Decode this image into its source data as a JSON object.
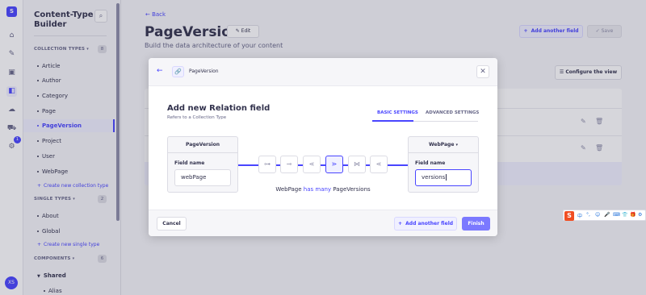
{
  "rail": {
    "logo": "S",
    "badge": "1",
    "avatar": "XS"
  },
  "subnav": {
    "title": "Content-Type Builder",
    "collection_types": {
      "label": "COLLECTION TYPES",
      "count": "8",
      "items": [
        "Article",
        "Author",
        "Category",
        "Page",
        "PageVersion",
        "Project",
        "User",
        "WebPage"
      ],
      "create": "Create new collection type"
    },
    "single_types": {
      "label": "SINGLE TYPES",
      "count": "2",
      "items": [
        "About",
        "Global"
      ],
      "create": "Create new single type"
    },
    "components": {
      "label": "COMPONENTS",
      "count": "6",
      "group": "Shared",
      "items": [
        "Alias"
      ]
    }
  },
  "main": {
    "back": "Back",
    "title": "PageVersion",
    "edit": "Edit",
    "subtitle": "Build the data architecture of your content",
    "add_another_field": "Add another field",
    "save": "Save",
    "configure_view": "Configure the view"
  },
  "modal": {
    "breadcrumb": "PageVersion",
    "title": "Add new Relation field",
    "subtitle": "Refers to a Collection Type",
    "tabs": [
      "BASIC SETTINGS",
      "ADVANCED SETTINGS"
    ],
    "left": {
      "header": "PageVersion",
      "label": "Field name",
      "value": "webPage"
    },
    "right": {
      "header": "WebPage",
      "label": "Field name",
      "value": "versions"
    },
    "relation_text": {
      "a": "WebPage",
      "b": "has many",
      "c": "PageVersions"
    },
    "cancel": "Cancel",
    "add_another_field": "Add another field",
    "finish": "Finish"
  },
  "ime": {
    "logo": "S",
    "items": [
      "中",
      "°,",
      "☺",
      "🎤",
      "⌨",
      "👕",
      "🎁",
      "⚙"
    ]
  },
  "colors": {
    "accent": "#4945ff",
    "accent_light": "#f0f0ff",
    "finish": "#7b79ff"
  }
}
